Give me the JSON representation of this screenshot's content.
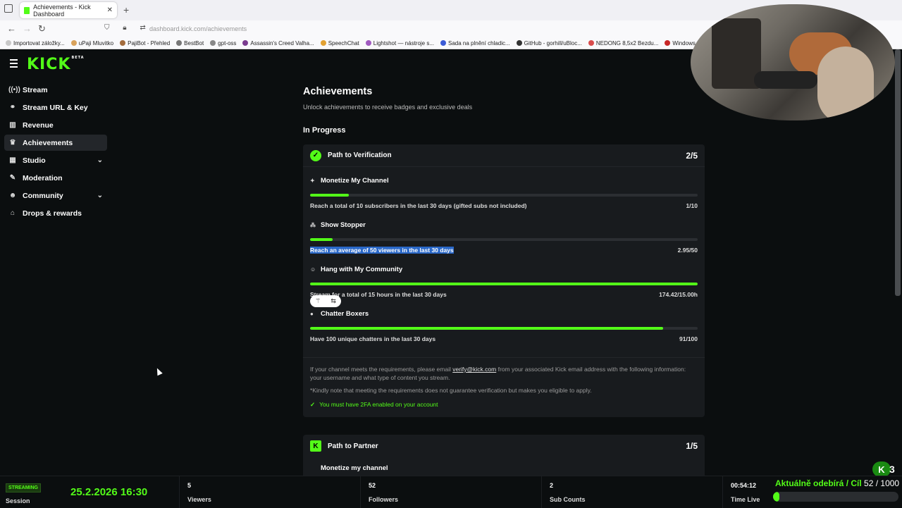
{
  "browser": {
    "tab_title": "Achievements - Kick Dashboard",
    "tab_close": "✕",
    "new_tab": "+",
    "url_domain": "dashboard.kick.com",
    "url_path": "/achievements",
    "bookmarks": [
      "Importovat záložky...",
      "uPaji Mluvitko",
      "PajiBot - Přehled",
      "BestBot",
      "gpt-oss",
      "Assassin's Creed Valha...",
      "SpeechChat",
      "Lightshot — nástroje s...",
      "Sada na plnění chladic...",
      "GitHub - gorhill/uBloc...",
      "NEDONG 8,5x2 Bezdu...",
      "Windows Sandbox po ..."
    ]
  },
  "brand": {
    "logo": "KICK",
    "logo_tag": "BETA",
    "accent": "#53fc18"
  },
  "sidebar": {
    "items": [
      {
        "label": "Stream",
        "icon": "broadcast-icon",
        "glyph": "((•))"
      },
      {
        "label": "Stream URL & Key",
        "icon": "link-icon",
        "glyph": "⚭"
      },
      {
        "label": "Revenue",
        "icon": "chart-icon",
        "glyph": "▥"
      },
      {
        "label": "Achievements",
        "icon": "trophy-icon",
        "glyph": "♛",
        "active": true
      },
      {
        "label": "Studio",
        "icon": "grid-icon",
        "glyph": "▦",
        "expandable": true
      },
      {
        "label": "Moderation",
        "icon": "wrench-icon",
        "glyph": "✎"
      },
      {
        "label": "Community",
        "icon": "users-icon",
        "glyph": "☻",
        "expandable": true
      },
      {
        "label": "Drops & rewards",
        "icon": "gift-icon",
        "glyph": "⌂"
      }
    ]
  },
  "main": {
    "title": "Achievements",
    "subtitle": "Unlock achievements to receive badges and exclusive deals",
    "section_title": "In Progress",
    "verification": {
      "title": "Path to Verification",
      "count": "2/5",
      "goals": [
        {
          "name": "Monetize My Channel",
          "glyph": "✦",
          "desc": "Reach a total of 10 subscribers in the last 30 days (gifted subs not included)",
          "value": "1/10",
          "progress": 0.1
        },
        {
          "name": "Show Stopper",
          "glyph": "⁂",
          "desc": "Reach an average of 50 viewers in the last 30 days",
          "value": "2.95/50",
          "progress": 0.059
        },
        {
          "name": "Hang with My Community",
          "glyph": "☺",
          "desc": "Stream for a total of 15 hours in the last 30 days",
          "value": "174.42/15.00h",
          "progress": 1.0
        },
        {
          "name": "Chatter Boxers",
          "glyph": "●",
          "desc": "Have 100 unique chatters in the last 30 days",
          "value": "91/100",
          "progress": 0.91
        }
      ],
      "info_before": "If your channel meets the requirements, please email",
      "info_email": "verify@kick.com",
      "info_after": "from your associated Kick email address with the following information: your username and what type of content you stream.",
      "note": "*Kindly note that meeting the requirements does not guarantee verification but makes you eligible to apply.",
      "check_text": "You must have 2FA enabled on your account"
    },
    "partner": {
      "title": "Path to Partner",
      "count": "1/5",
      "first_goal": "Monetize my channel"
    }
  },
  "footer": {
    "streaming": "STREAMING",
    "session_label": "Session",
    "datetime": "25.2.2026 16:30",
    "viewers_value": "5",
    "viewers_label": "Viewers",
    "followers_value": "52",
    "followers_label": "Followers",
    "subs_value": "2",
    "subs_label": "Sub Counts",
    "time_value": "00:54:12",
    "time_label": "Time Live",
    "sub_goal_label": "Aktuálně odebírá / Cíl",
    "sub_goal_count": "52 / 1000",
    "sub_goal_progress": 0.052,
    "badge_count": "3"
  }
}
